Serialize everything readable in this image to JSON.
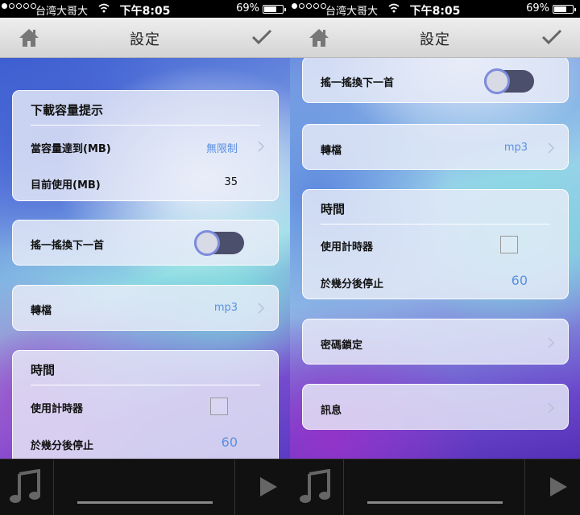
{
  "status": {
    "carrier": "台湾大哥大",
    "time": "下午8:05",
    "battery": "69%"
  },
  "nav": {
    "title": "設定"
  },
  "left": {
    "download": {
      "header": "下載容量提示",
      "limit_label": "當容量達到(MB)",
      "limit_value": "無限制",
      "usage_label": "目前使用(MB)",
      "usage_value": "35"
    },
    "shake": {
      "label": "搖一搖換下一首",
      "enabled": true
    },
    "convert": {
      "label": "轉檔",
      "value": "mp3"
    },
    "timer": {
      "header": "時間",
      "use_label": "使用計時器",
      "stop_label": "於幾分後停止",
      "stop_value": "60"
    }
  },
  "right": {
    "shake": {
      "label": "搖一搖換下一首",
      "enabled": true
    },
    "convert": {
      "label": "轉檔",
      "value": "mp3"
    },
    "timer": {
      "header": "時間",
      "use_label": "使用計時器",
      "stop_label": "於幾分後停止",
      "stop_value": "60"
    },
    "passcode": {
      "label": "密碼鎖定"
    },
    "info": {
      "label": "訊息"
    }
  },
  "icons": [
    "home-icon",
    "checkmark-icon",
    "chevron-right-icon",
    "music-note-icon",
    "play-icon",
    "wifi-icon"
  ],
  "colors": {
    "accent": "#5b8fe0",
    "toggle_track": "#4c4f6b",
    "toggle_ring": "#7d8cdc"
  }
}
